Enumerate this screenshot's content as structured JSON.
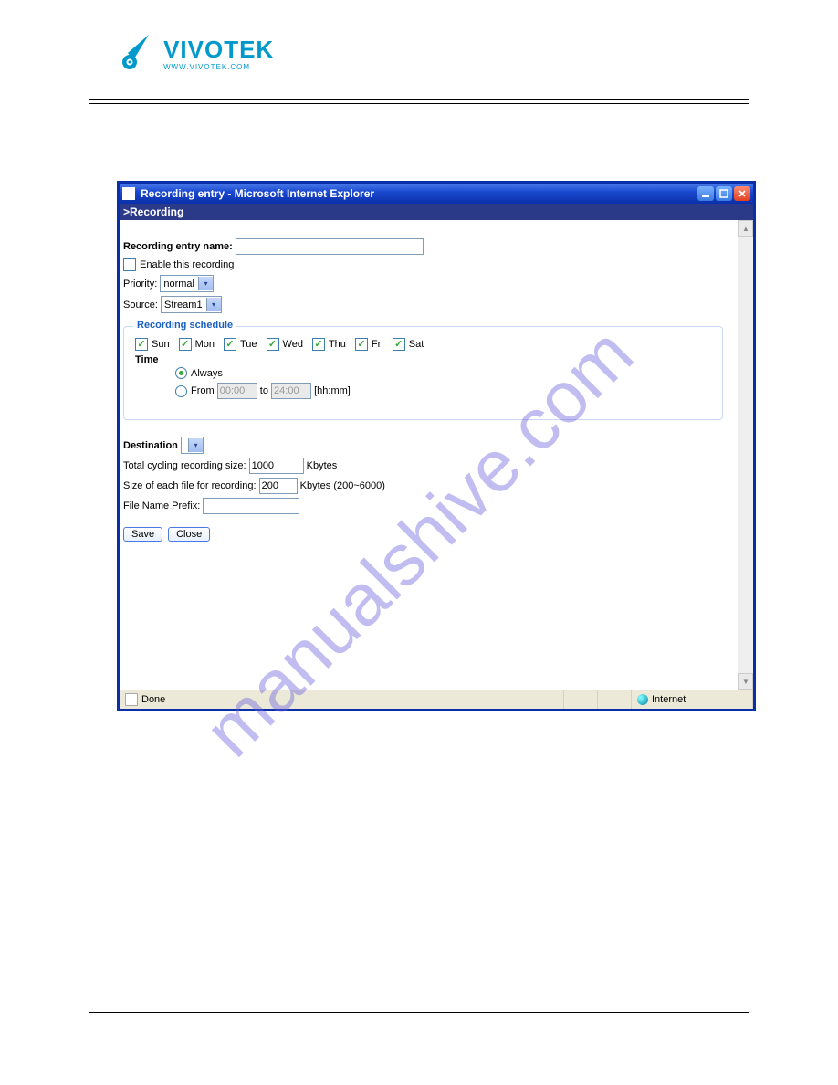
{
  "logo": {
    "brand": "VIVOTEK",
    "url": "WWW.VIVOTEK.COM"
  },
  "watermark": "manualshive.com",
  "window": {
    "title": "Recording entry - Microsoft Internet Explorer",
    "subheader": ">Recording",
    "form": {
      "entry_name_label": "Recording entry name:",
      "entry_name_value": "",
      "enable_label": "Enable this recording",
      "enable_checked": false,
      "priority_label": "Priority:",
      "priority_value": "normal",
      "source_label": "Source:",
      "source_value": "Stream1"
    },
    "schedule": {
      "legend": "Recording schedule",
      "days": [
        "Sun",
        "Mon",
        "Tue",
        "Wed",
        "Thu",
        "Fri",
        "Sat"
      ],
      "time_label": "Time",
      "always_label": "Always",
      "from_label": "From",
      "from_value": "00:00",
      "to_label": "to",
      "to_value": "24:00",
      "hint": "[hh:mm]"
    },
    "dest": {
      "label": "Destination",
      "value": "",
      "total_label": "Total cycling recording size:",
      "total_value": "1000",
      "total_unit": "Kbytes",
      "each_label": "Size of each file for recording:",
      "each_value": "200",
      "each_unit": "Kbytes (200~6000)",
      "prefix_label": "File Name Prefix:",
      "prefix_value": ""
    },
    "buttons": {
      "save": "Save",
      "close": "Close"
    },
    "status": {
      "done": "Done",
      "zone": "Internet"
    }
  }
}
